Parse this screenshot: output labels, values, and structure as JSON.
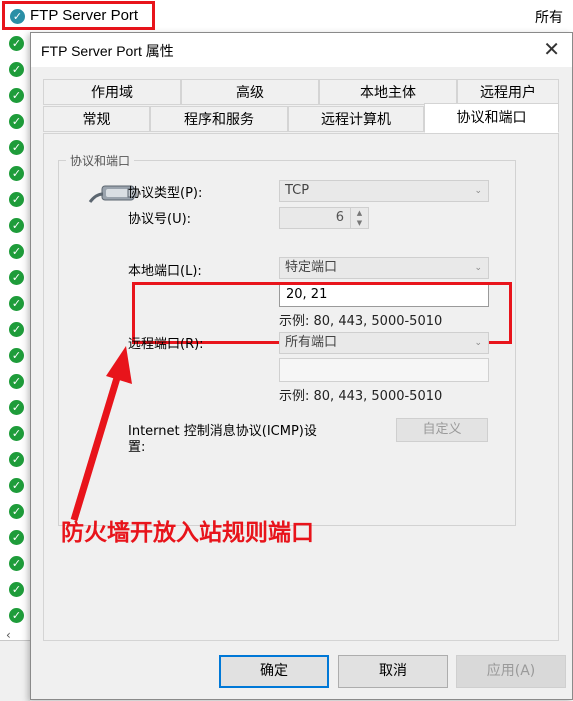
{
  "background_window": {
    "title": "FTP Server Port",
    "status_column": "所有",
    "scroll_left_arrow": "‹"
  },
  "dialog": {
    "title": "FTP Server Port 属性",
    "close_glyph": "✕",
    "tabs_row1": [
      "作用域",
      "高级",
      "本地主体",
      "远程用户"
    ],
    "tabs_row2": [
      "常规",
      "程序和服务",
      "远程计算机",
      "协议和端口"
    ],
    "active_tab": "协议和端口",
    "group_title": "协议和端口",
    "protocol_type_label": "协议类型(P):",
    "protocol_type_value": "TCP",
    "protocol_number_label": "协议号(U):",
    "protocol_number_value": "6",
    "local_port_label": "本地端口(L):",
    "local_port_select": "特定端口",
    "local_port_value": "20, 21",
    "local_port_hint": "示例: 80, 443, 5000-5010",
    "remote_port_label": "远程端口(R):",
    "remote_port_select": "所有端口",
    "remote_port_value": "",
    "remote_port_hint": "示例: 80, 443, 5000-5010",
    "icmp_label_line1": "Internet 控制消息协议(ICMP)设",
    "icmp_label_line2": "置:",
    "custom_button": "自定义",
    "annotation": "防火墙开放入站规则端口",
    "ok_button": "确定",
    "cancel_button": "取消",
    "apply_button": "应用(A)"
  },
  "colors": {
    "highlight_red": "#e8141b",
    "check_green": "#1e9c3a",
    "accent_blue": "#0078d7"
  },
  "icons": {
    "row_status": "green-check-icon",
    "header_status": "teal-check-icon",
    "protocol": "network-cable-icon"
  }
}
